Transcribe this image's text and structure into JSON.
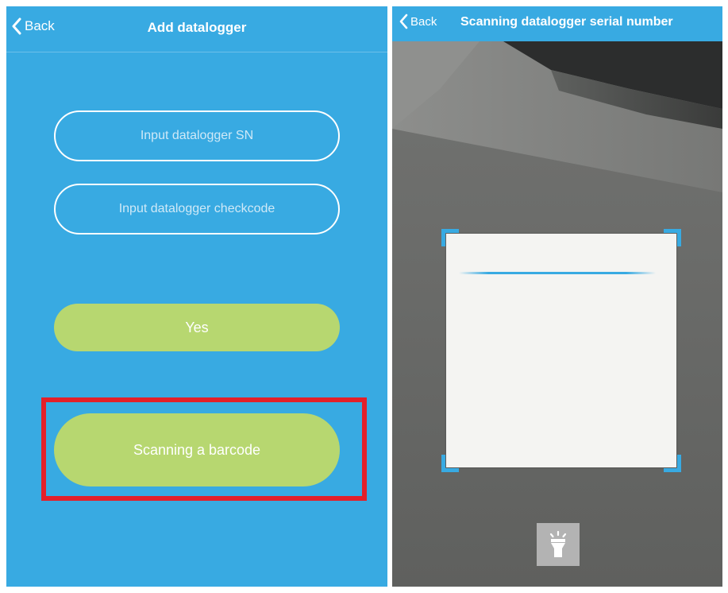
{
  "left": {
    "nav": {
      "back_label": "Back",
      "title": "Add datalogger"
    },
    "form": {
      "sn_placeholder": "Input datalogger SN",
      "checkcode_placeholder": "Input datalogger checkcode",
      "yes_label": "Yes",
      "scan_label": "Scanning a barcode"
    }
  },
  "right": {
    "nav": {
      "back_label": "Back",
      "title": "Scanning datalogger serial number"
    }
  },
  "icons": {
    "back": "chevron-left-icon",
    "flashlight": "flashlight-icon"
  },
  "colors": {
    "primary": "#38aae2",
    "button": "#b7d770",
    "highlight": "#e3202a",
    "scan_frame": "#38aae2"
  }
}
